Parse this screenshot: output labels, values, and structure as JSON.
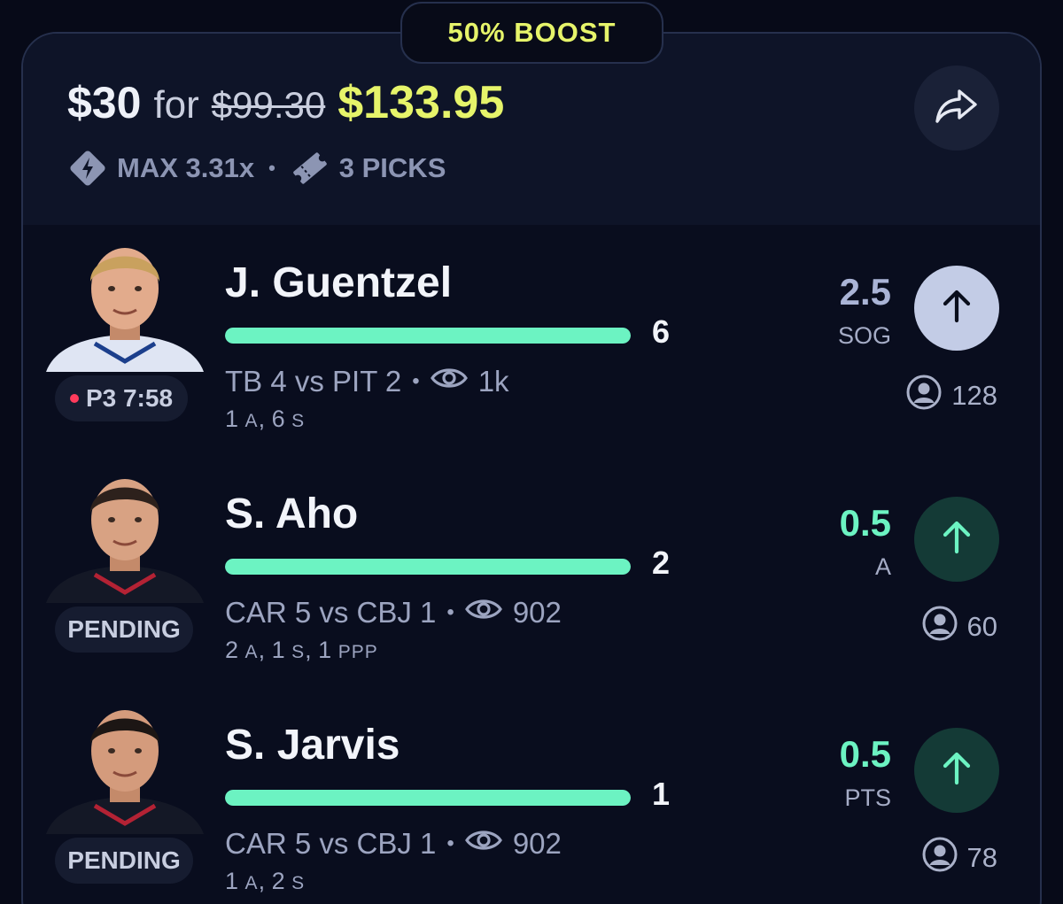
{
  "boost": {
    "label": "50% BOOST"
  },
  "payout": {
    "stake": "$30",
    "for_word": "for",
    "original": "$99.30",
    "boosted": "$133.95"
  },
  "meta": {
    "max_label": "MAX 3.31x",
    "separator": "•",
    "picks_label": "3 PICKS"
  },
  "colors": {
    "accent_yellow": "#e6f46a",
    "progress_green": "#6cf3c2",
    "live_red": "#ff3b5c"
  },
  "picks": [
    {
      "player": "J. Guentzel",
      "status": "P3 7:58",
      "status_live": true,
      "progress_value": "6",
      "progress_fraction": 1.0,
      "matchup": "TB 4 vs PIT 2",
      "viewers": "1k",
      "stats": [
        {
          "n": "1",
          "u": "A"
        },
        {
          "n": "6",
          "u": "S"
        }
      ],
      "line": "2.5",
      "stat_type": "SOG",
      "direction": "up",
      "line_color": "#aab4d6",
      "button_theme": "light",
      "pickers": "128"
    },
    {
      "player": "S. Aho",
      "status": "PENDING",
      "status_live": false,
      "progress_value": "2",
      "progress_fraction": 1.0,
      "matchup": "CAR 5 vs CBJ 1",
      "viewers": "902",
      "stats": [
        {
          "n": "2",
          "u": "A"
        },
        {
          "n": "1",
          "u": "S"
        },
        {
          "n": "1",
          "u": "PPP"
        }
      ],
      "line": "0.5",
      "stat_type": "A",
      "direction": "up",
      "line_color": "#6cf3c2",
      "button_theme": "green",
      "pickers": "60"
    },
    {
      "player": "S. Jarvis",
      "status": "PENDING",
      "status_live": false,
      "progress_value": "1",
      "progress_fraction": 1.0,
      "matchup": "CAR 5 vs CBJ 1",
      "viewers": "902",
      "stats": [
        {
          "n": "1",
          "u": "A"
        },
        {
          "n": "2",
          "u": "S"
        }
      ],
      "line": "0.5",
      "stat_type": "PTS",
      "direction": "up",
      "line_color": "#6cf3c2",
      "button_theme": "green",
      "pickers": "78"
    }
  ]
}
